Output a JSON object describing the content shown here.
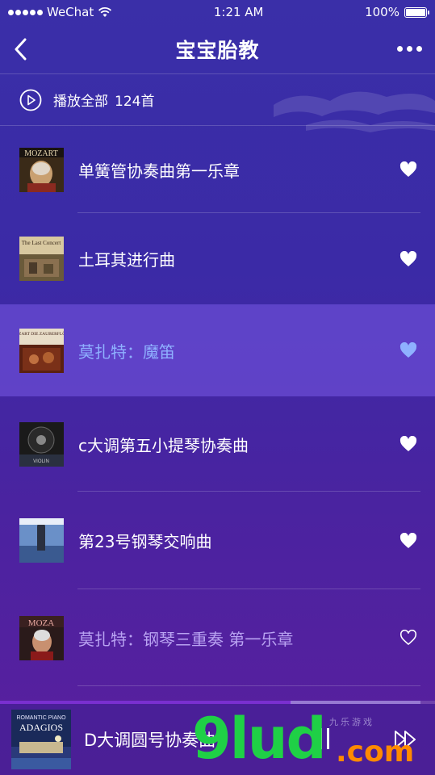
{
  "status_bar": {
    "carrier": "WeChat",
    "time": "1:21 AM",
    "battery": "100%"
  },
  "nav": {
    "title": "宝宝胎教"
  },
  "play_all": {
    "label": "播放全部",
    "count": "124首"
  },
  "songs": [
    {
      "title": "单簧管协奏曲第一乐章",
      "state": "normal",
      "liked": true
    },
    {
      "title": "土耳其进行曲",
      "state": "normal",
      "liked": true
    },
    {
      "title": "莫扎特：魔笛",
      "state": "playing",
      "liked": true
    },
    {
      "title": "c大调第五小提琴协奏曲",
      "state": "normal",
      "liked": true
    },
    {
      "title": "第23号钢琴交响曲",
      "state": "normal",
      "liked": true
    },
    {
      "title": "莫扎特：钢琴三重奏 第一乐章",
      "state": "muted",
      "liked": false
    }
  ],
  "player": {
    "title": "D大调圆号协奏曲",
    "progress": 0.67
  },
  "watermark": {
    "main": "9lud",
    "com": ".com",
    "cn": "九乐游戏"
  },
  "colors": {
    "background_top": "#3a2fa8",
    "background_bottom": "#5a1f9e",
    "highlight_row": "#6e4fd6",
    "active_text": "#8fb1ff",
    "watermark_green": "#1fd046",
    "watermark_orange": "#ff8a00"
  }
}
